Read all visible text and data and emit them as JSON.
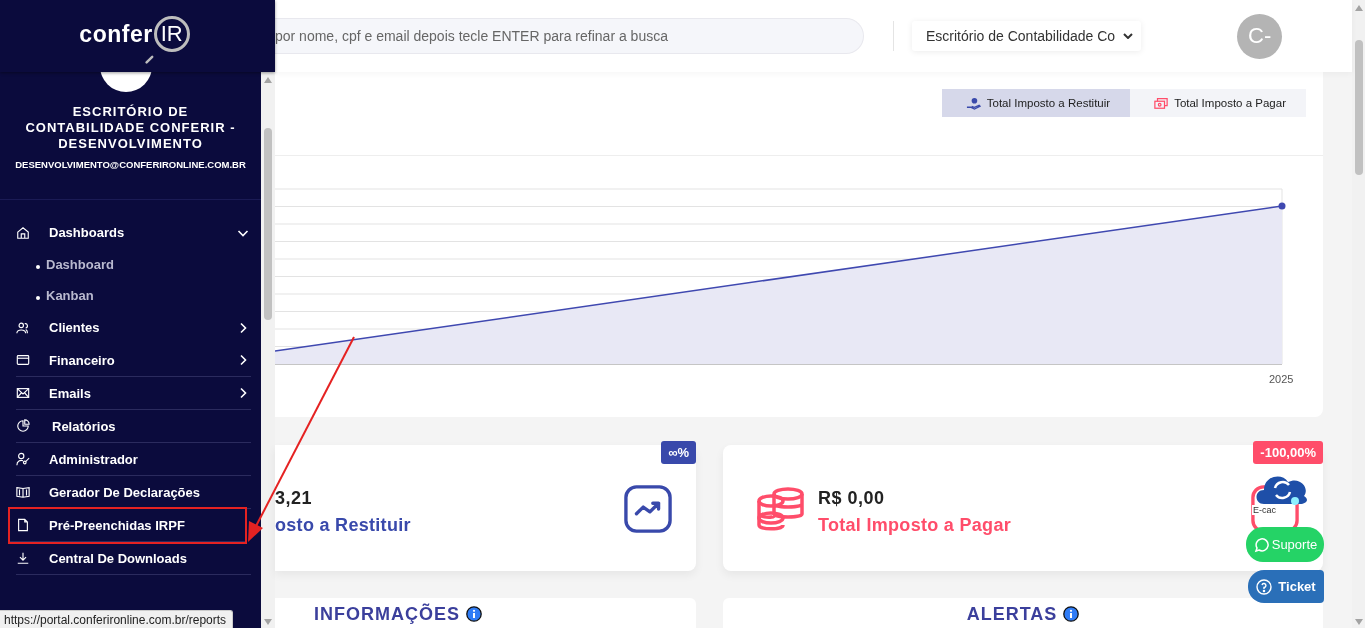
{
  "sidebar": {
    "logo": {
      "text": "confer",
      "mark": "IR"
    },
    "account": {
      "name": "ESCRITÓRIO DE CONTABILIDADE CONFERIR - DESENVOLVIMENTO",
      "email": "DESENVOLVIMENTO@CONFERIRONLINE.COM.BR"
    },
    "menu": [
      {
        "label": "Dashboards",
        "kind": "group",
        "expanded": true,
        "highlighted": false,
        "children": [
          {
            "label": "Dashboard"
          },
          {
            "label": "Kanban"
          }
        ]
      },
      {
        "label": "Clientes",
        "kind": "group",
        "expanded": false,
        "highlighted": false
      },
      {
        "label": "Financeiro",
        "kind": "group",
        "expanded": false,
        "highlighted": false
      },
      {
        "label": "Emails",
        "kind": "group",
        "expanded": false,
        "highlighted": false
      },
      {
        "label": "Relatórios",
        "kind": "link",
        "highlighted": false
      },
      {
        "label": "Administrador",
        "kind": "link",
        "highlighted": false
      },
      {
        "label": "Gerador De Declarações",
        "kind": "link",
        "highlighted": false
      },
      {
        "label": "Pré-Preenchidas IRPF",
        "kind": "link",
        "highlighted": true
      },
      {
        "label": "Central De Downloads",
        "kind": "link",
        "highlighted": false
      }
    ]
  },
  "header": {
    "search": {
      "placeholder": "por nome, cpf e email depois tecle ENTER para refinar a busca"
    },
    "office_select": {
      "value": "Escritório de Contabilidade Co"
    },
    "avatar": "C-"
  },
  "chart_card": {
    "tabs": [
      {
        "label": "Total Imposto a Restituir",
        "selected": true
      },
      {
        "label": "Total Imposto a Pagar",
        "selected": false
      }
    ],
    "x_label": "2025"
  },
  "stat_cards": [
    {
      "value": "3,21",
      "label": "osto a Restituir",
      "badge": "∞%",
      "color": "#3949ab"
    },
    {
      "value": "R$ 0,00",
      "label": "Total Imposto a Pagar",
      "badge": "-100,00%",
      "color": "#ff4d6a"
    }
  ],
  "sections": [
    {
      "title": "INFORMAÇÕES"
    },
    {
      "title": "ALERTAS"
    }
  ],
  "floating": {
    "ecac": "E-cac",
    "support": "Suporte",
    "ticket": "Ticket"
  },
  "status_url": "https://portal.conferironline.com.br/reports"
}
